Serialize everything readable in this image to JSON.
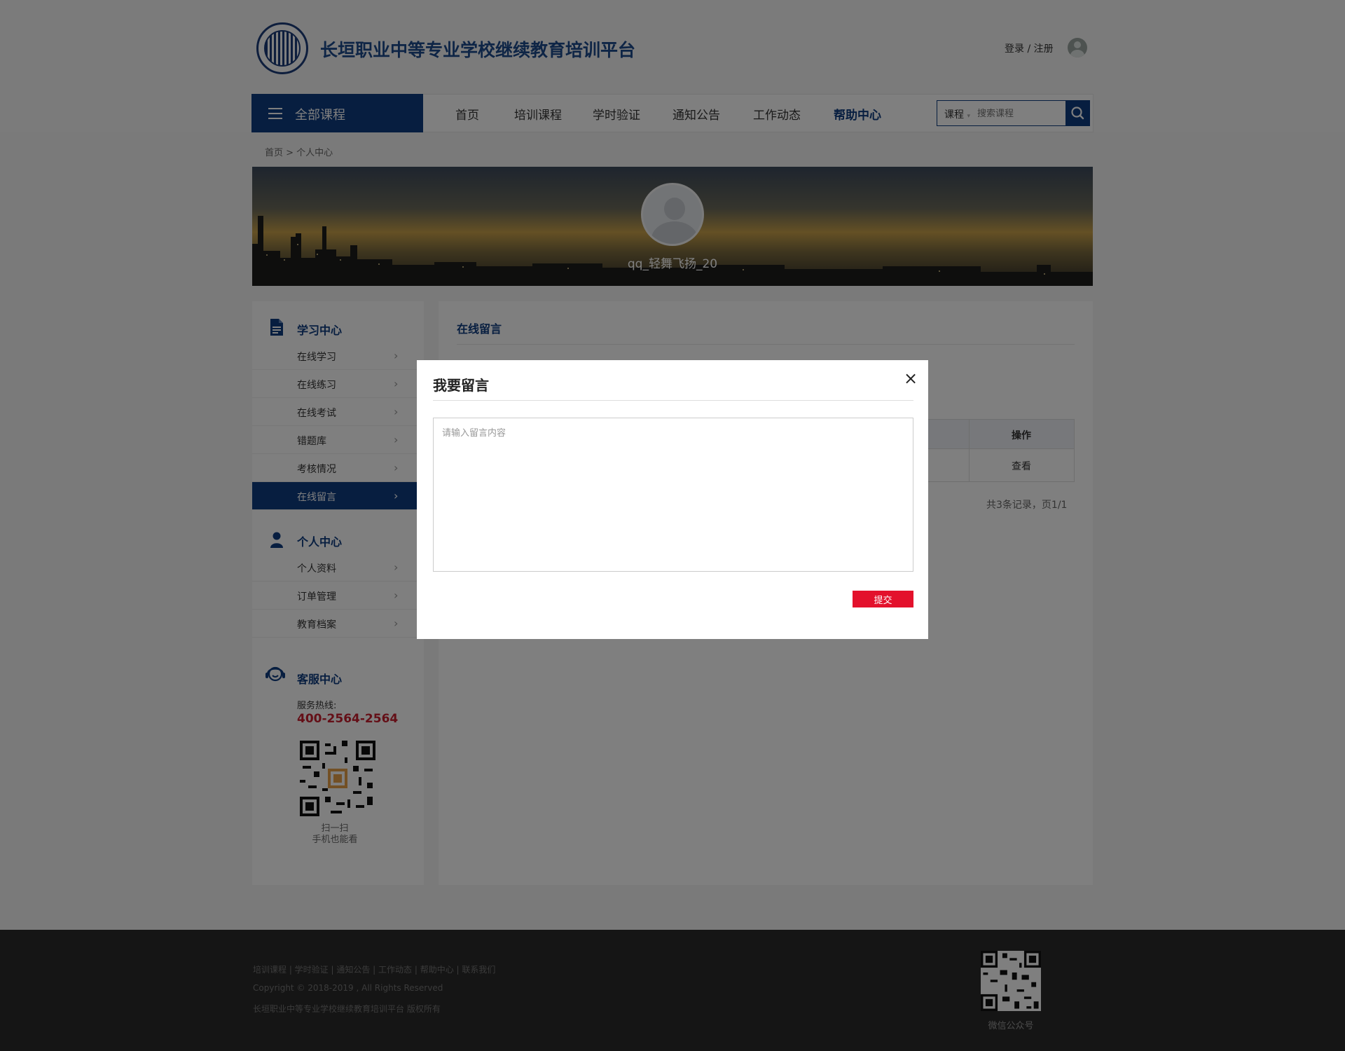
{
  "header": {
    "site_title": "长垣职业中等专业学校继续教育培训平台",
    "login_link": "登录 / 注册"
  },
  "nav": {
    "all_courses": "全部课程",
    "items": [
      "首页",
      "培训课程",
      "学时验证",
      "通知公告",
      "工作动态",
      "帮助中心"
    ],
    "active_index": 5,
    "search_category": "课程",
    "search_placeholder": "搜索课程"
  },
  "breadcrumb": "首页  >  个人中心",
  "profile": {
    "username": "qq_轻舞飞扬_20"
  },
  "sidebar": {
    "study_title": "学习中心",
    "study_items": [
      "在线学习",
      "在线练习",
      "在线考试",
      "错题库",
      "考核情况",
      "在线留言"
    ],
    "active_study_index": 5,
    "personal_title": "个人中心",
    "personal_items": [
      "个人资料",
      "订单管理",
      "教育档案"
    ],
    "service_title": "客服中心",
    "hotline_label": "服务热线:",
    "hotline": "400-2564-2564",
    "scan_line1": "扫一扫",
    "scan_line2": "手机也能看"
  },
  "main": {
    "title": "在线留言",
    "table_header_op": "操作",
    "row_action": "查看",
    "pager": "共3条记录，页1/1"
  },
  "modal": {
    "title": "我要留言",
    "close": "×",
    "placeholder": "请输入留言内容",
    "submit": "提交"
  },
  "footer": {
    "links": "培训课程 | 学时验证 | 通知公告 | 工作动态 | 帮助中心 | 联系我们",
    "copyright": "Copyright © 2018-2019 , All Rights Reserved",
    "org": "长垣职业中等专业学校继续教育培训平台  版权所有",
    "qr_label": "微信公众号"
  },
  "colors": {
    "brand_blue": "#0f3c80",
    "accent_red": "#e3112c",
    "hotline_red": "#c81e2e"
  }
}
